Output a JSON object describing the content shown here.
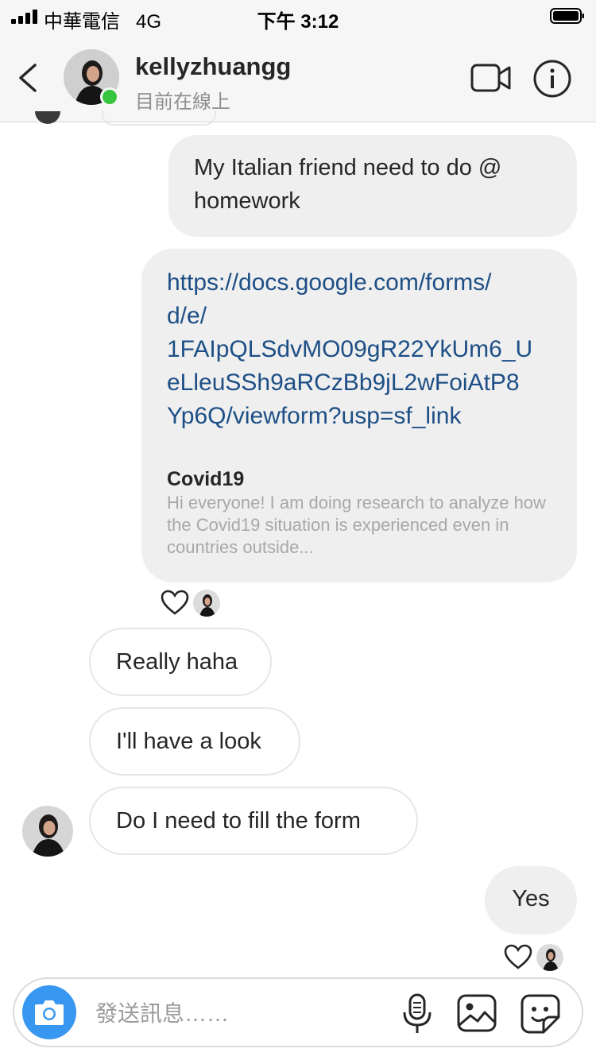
{
  "status_bar": {
    "carrier": "中華電信",
    "network": "4G",
    "time": "下午 3:12"
  },
  "header": {
    "username": "kellyzhuangg",
    "status": "目前在線上",
    "icons": [
      "back-chevron-icon",
      "video-call-icon",
      "info-icon"
    ]
  },
  "messages": [
    {
      "from": "me",
      "text": "My  Italian friend need to do @ homework"
    },
    {
      "from": "me",
      "link": "https://docs.google.com/forms/d/e/1FAIpQLSdvMO09gR22YkUm6_UeLleuSSh9aRCzBb9jL2wFoiAtP8Yp6Q/viewform?usp=sf_link",
      "link_lines": [
        "https://docs.google.com/forms/",
        "d/e/",
        "1FAIpQLSdvMO09gR22YkUm6_U",
        "eLleuSSh9aRCzBb9jL2wFoiAtP8",
        "Yp6Q/viewform?usp=sf_link"
      ],
      "preview_title": "Covid19",
      "preview_desc": "Hi everyone! I am doing research to analyze how the Covid19 situation is experienced even in countries outside..."
    },
    {
      "from": "them",
      "text": "Really haha"
    },
    {
      "from": "them",
      "text": "I'll have a look"
    },
    {
      "from": "them",
      "text": "Do I need to fill the form"
    },
    {
      "from": "me",
      "text": "Yes"
    }
  ],
  "composer": {
    "placeholder": "發送訊息……"
  },
  "colors": {
    "online": "#37c53e",
    "camera_button": "#3897f0",
    "link": "#1d4f86"
  }
}
